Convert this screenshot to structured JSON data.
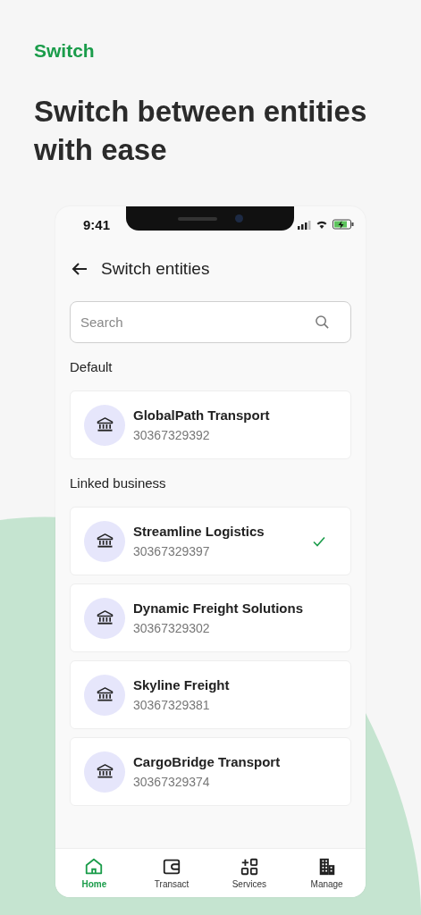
{
  "eyebrow": "Switch",
  "headline": "Switch between entities with ease",
  "status_bar": {
    "time": "9:41"
  },
  "screen_title": "Switch entities",
  "search": {
    "placeholder": "Search"
  },
  "sections": [
    {
      "title": "Default",
      "entities": [
        {
          "name": "GlobalPath Transport",
          "number": "30367329392",
          "selected": false
        }
      ]
    },
    {
      "title": "Linked business",
      "entities": [
        {
          "name": "Streamline Logistics",
          "number": "30367329397",
          "selected": true
        },
        {
          "name": "Dynamic Freight Solutions",
          "number": "30367329302",
          "selected": false
        },
        {
          "name": "Skyline Freight",
          "number": "30367329381",
          "selected": false
        },
        {
          "name": "CargoBridge Transport",
          "number": "30367329374",
          "selected": false
        }
      ]
    }
  ],
  "tabs": [
    {
      "label": "Home",
      "kind": "home",
      "selected": true
    },
    {
      "label": "Transact",
      "kind": "wallet",
      "selected": false
    },
    {
      "label": "Services",
      "kind": "grid",
      "selected": false
    },
    {
      "label": "Manage",
      "kind": "building",
      "selected": false
    }
  ]
}
